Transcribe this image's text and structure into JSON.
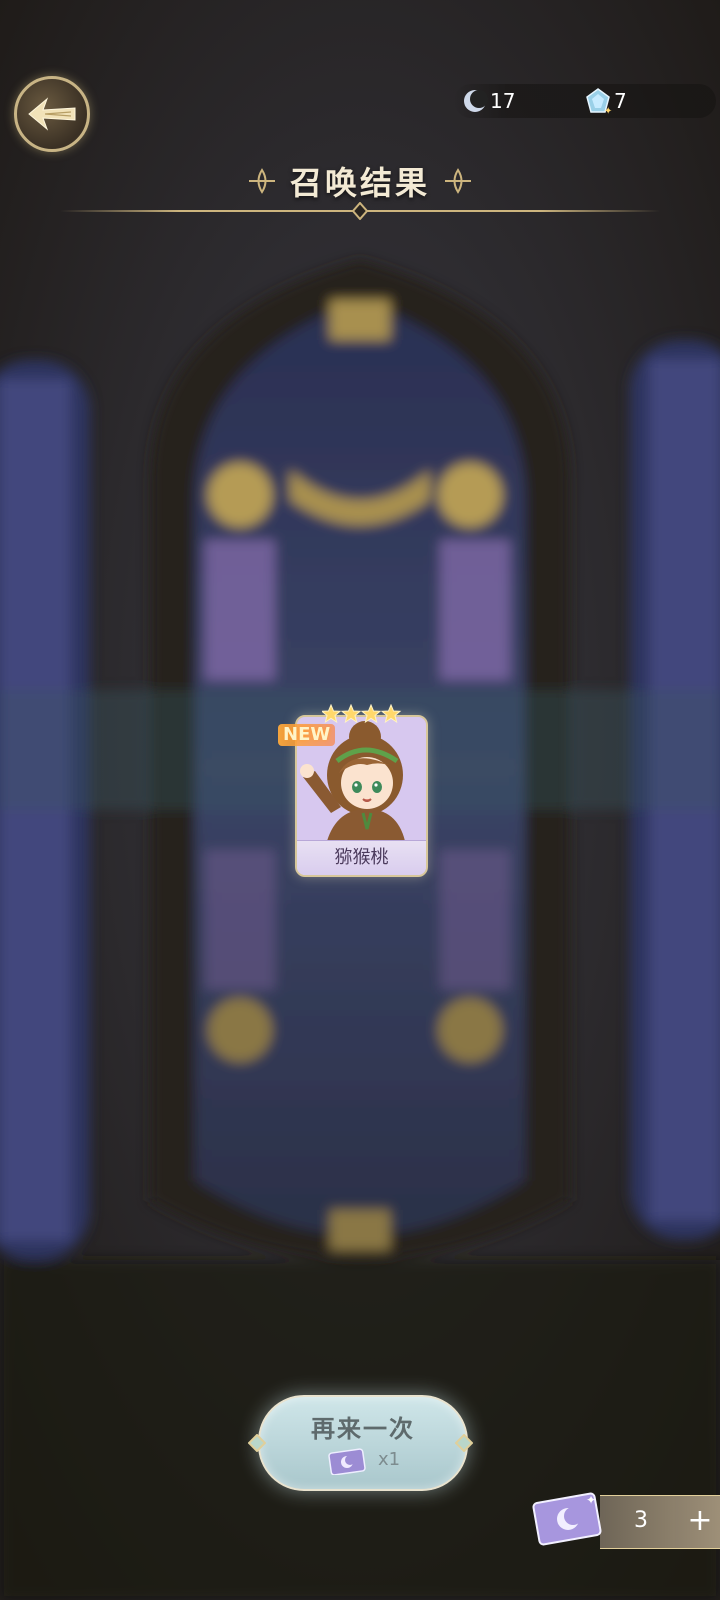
{
  "header": {
    "title": "召唤结果"
  },
  "currency": {
    "moon": {
      "icon": "moon-icon",
      "value": "17"
    },
    "crystal": {
      "icon": "crystal-icon",
      "value": "7"
    }
  },
  "result": {
    "rarity_stars": 4,
    "new_label": "NEW",
    "name": "猕猴桃"
  },
  "actions": {
    "summon_again_label": "再来一次",
    "summon_again_cost": "x1",
    "ticket_count": "3",
    "add_symbol": "+"
  },
  "colors": {
    "accent_gold": "#cdb57e",
    "card_purple": "#c8b6e8",
    "button_teal": "#bcd8dc"
  }
}
